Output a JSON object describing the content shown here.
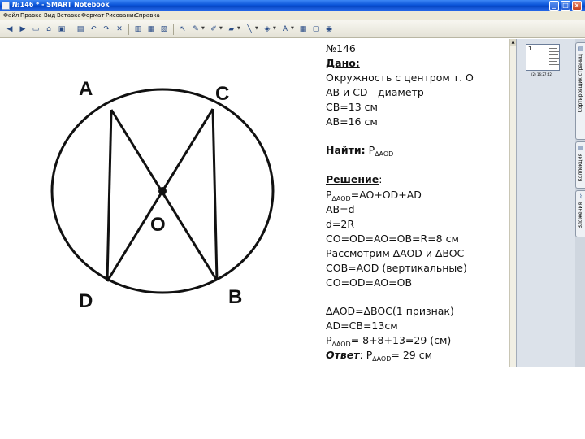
{
  "window": {
    "title": "№146 * - SMART Notebook",
    "controls": {
      "minimize": "_",
      "maximize": "□",
      "close": "×"
    }
  },
  "menu": [
    "Файл",
    "Правка",
    "Вид",
    "Вставка",
    "Формат",
    "Рисование",
    "Справка"
  ],
  "toolbar": {
    "icons": [
      "previous-page-icon",
      "next-page-icon",
      "blank-page-icon",
      "open-icon",
      "save-icon",
      "paste-icon",
      "undo-icon",
      "redo-icon",
      "delete-icon",
      "screen-shade-icon",
      "full-screen-icon",
      "capture-icon",
      "select-icon",
      "pen-icon",
      "creative-pen-icon",
      "eraser-icon",
      "line-icon",
      "fill-icon",
      "text-icon",
      "table-icon",
      "properties-icon",
      "dual-page-icon"
    ]
  },
  "side_panel": {
    "thumbnail_number": "1",
    "thumbnail_caption": "(2) 16:27:42",
    "tabs": [
      "Сортировщик страниц",
      "Коллекция",
      "Вложения"
    ]
  },
  "figure": {
    "labels": {
      "a": "A",
      "c": "C",
      "o": "O",
      "d": "D",
      "b": "B"
    }
  },
  "notes": {
    "number": "№146",
    "given_heading": "Дано:",
    "given": [
      "Окружность с центром т. О",
      "АВ и CD - диаметр",
      "CB=13 см",
      "AB=16 см"
    ],
    "dashes": "-------------------------------",
    "find_label": "Найти:",
    "find_p": "P",
    "find_sub": "∆AOD",
    "solution_heading": "Решение",
    "solution_colon": ":",
    "perimeter_p": "P",
    "perimeter_sub": "∆AOD",
    "perimeter_rest": "=AO+OD+AD",
    "steps": [
      "AB=d",
      "d=2R",
      "CO=OD=AO=OB=R=8 см",
      "Рассмотрим ∆AOD и  ∆BOC",
      "COB=AOD (вертикальные)",
      "CO=OD=AO=OB"
    ],
    "congruence": "∆AOD=∆BOC(1 признак)",
    "ad_eq": "AD=CB=13см",
    "result_p": "P",
    "result_sub": "∆AOD",
    "result_rest": "= 8+8+13=29 (см)",
    "answer_label": "Ответ",
    "answer_colon": ": P",
    "answer_sub": "∆AOD",
    "answer_rest": "= 29 см"
  }
}
